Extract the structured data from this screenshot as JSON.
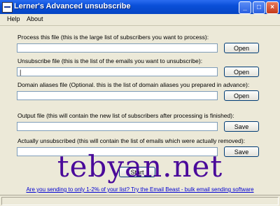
{
  "window": {
    "title": "Lerner's Advanced unsubscribe",
    "minimize_glyph": "_",
    "maximize_glyph": "□",
    "close_glyph": "×"
  },
  "menu": [
    "Help",
    "About"
  ],
  "sections": [
    {
      "label": "Process this file (this is the large list of subscribers you want to process):",
      "value": "",
      "button": "Open"
    },
    {
      "label": "Unsubscribe file (this is the list of the emails you want to unsubscribe):",
      "value": "|",
      "button": "Open"
    },
    {
      "label": "Domain aliases file (Optional. this is the list of domain aliases you prepared in advance):",
      "value": "",
      "button": "Open"
    },
    {
      "label": "Output file (this will contain the new list of subscribers after processing is finished):",
      "value": "",
      "button": "Save"
    },
    {
      "label": "Actually unsubscribed (this will contain the list of emails which were actually removed):",
      "value": "",
      "button": "Save"
    }
  ],
  "start_label": "Start",
  "promo_link": "Are you sending to only 1-2% of your list? Try the Email Beast - bulk email sending software",
  "watermark": "tebyan.net",
  "colors": {
    "titlebar": "#0a4fd8",
    "link": "#0000d0",
    "watermark": "#4a0a9a"
  }
}
